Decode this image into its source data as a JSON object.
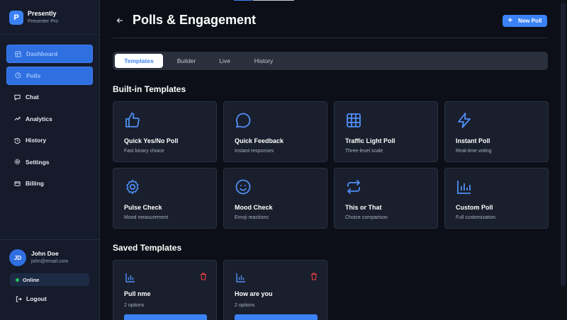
{
  "brand": {
    "logo_letter": "P",
    "name": "Presently",
    "subtitle": "Presenter Pro"
  },
  "sidebar": {
    "items": [
      {
        "label": "Dashboard",
        "icon": "grid-icon",
        "active": true
      },
      {
        "label": "Polls",
        "icon": "clock-icon",
        "active": true
      },
      {
        "label": "Chat",
        "icon": "chat-icon",
        "active": false
      },
      {
        "label": "Analytics",
        "icon": "trend-icon",
        "active": false
      },
      {
        "label": "History",
        "icon": "history-icon",
        "active": false
      },
      {
        "label": "Settings",
        "icon": "gear-icon",
        "active": false
      },
      {
        "label": "Billing",
        "icon": "card-icon",
        "active": false
      }
    ],
    "user": {
      "initials": "JD",
      "name": "John Doe",
      "email": "john@email.com"
    },
    "status": "Online",
    "logout": "Logout"
  },
  "header": {
    "title": "Polls & Engagement",
    "new_poll_label": "New Poll"
  },
  "tabs": [
    {
      "label": "Templates",
      "active": true
    },
    {
      "label": "Builder",
      "active": false
    },
    {
      "label": "Live",
      "active": false
    },
    {
      "label": "History",
      "active": false
    }
  ],
  "builtin": {
    "title": "Built-in Templates",
    "templates": [
      {
        "title": "Quick Yes/No Poll",
        "desc": "Fast binary choice",
        "icon": "thumbs-up-icon"
      },
      {
        "title": "Quick Feedback",
        "desc": "Instant responses",
        "icon": "speech-bubble-icon"
      },
      {
        "title": "Traffic Light Poll",
        "desc": "Three-level scale",
        "icon": "grid-icon"
      },
      {
        "title": "Instant Poll",
        "desc": "Real-time voting",
        "icon": "lightning-icon"
      },
      {
        "title": "Pulse Check",
        "desc": "Mood measurement",
        "icon": "gear-icon"
      },
      {
        "title": "Mood Check",
        "desc": "Emoji reactions",
        "icon": "smiley-icon"
      },
      {
        "title": "This or That",
        "desc": "Choice comparison",
        "icon": "repeat-icon"
      },
      {
        "title": "Custom Poll",
        "desc": "Full customization",
        "icon": "bar-chart-icon"
      }
    ]
  },
  "saved": {
    "title": "Saved Templates",
    "templates": [
      {
        "title": "Pull nme",
        "sub": "2 options"
      },
      {
        "title": "How are you",
        "sub": "2 options"
      }
    ]
  },
  "colors": {
    "accent": "#3b82f6",
    "bg": "#0c0f17",
    "card": "#1a1f2d",
    "danger": "#ef4444",
    "online": "#22c55e"
  }
}
